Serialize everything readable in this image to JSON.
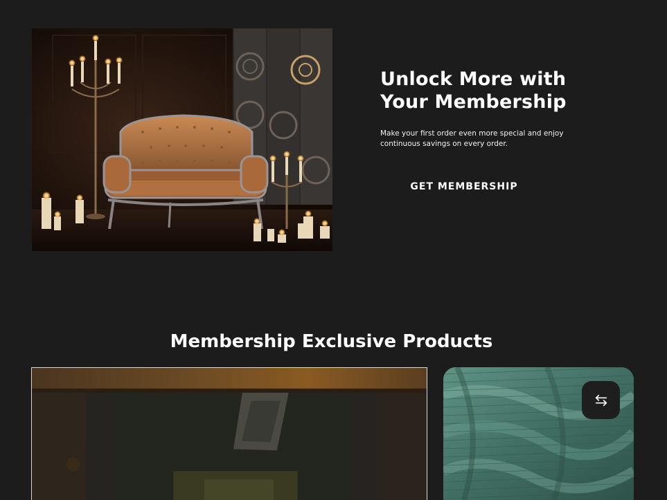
{
  "membership": {
    "title_line1": "Unlock More with",
    "title_line2": "Your Membership",
    "description": "Make your first order even more special and enjoy continuous savings on every order.",
    "cta_label": "GET MEMBERSHIP"
  },
  "exclusive": {
    "title": "Membership Exclusive Products"
  },
  "icons": {
    "compare": "compare-arrows-icon"
  },
  "colors": {
    "background": "#1c1c1c",
    "text": "#ffffff",
    "icon_button_bg": "#1e1e1e",
    "fabric_green": "#4f8074"
  }
}
